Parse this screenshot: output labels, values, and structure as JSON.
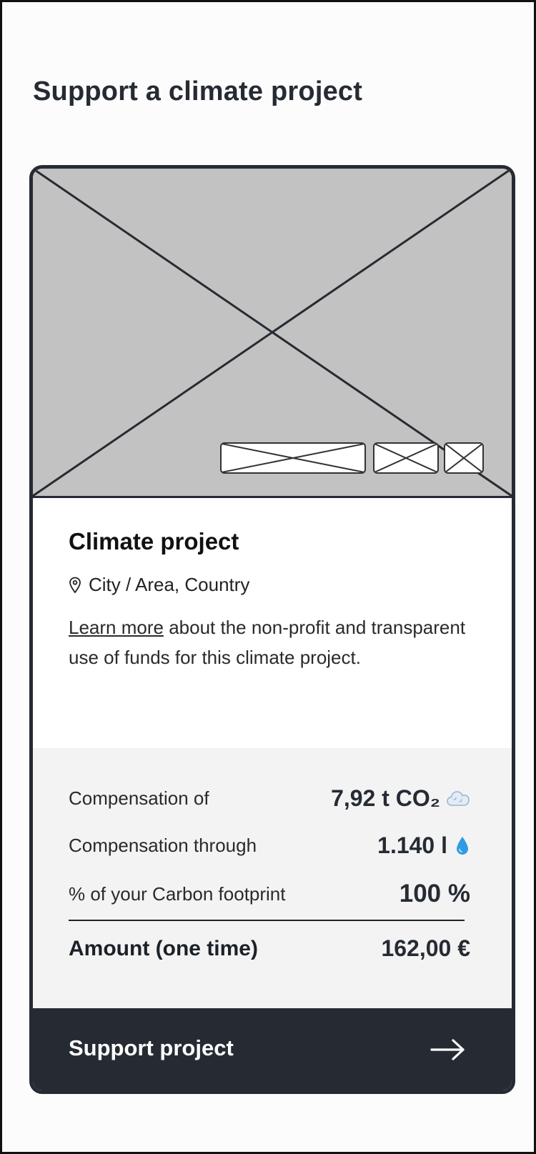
{
  "page": {
    "title": "Support a climate project"
  },
  "project": {
    "title": "Climate project",
    "location": "City / Area, Country",
    "learn_more": "Learn more",
    "description": " about the non-profit and transparent use of funds for this climate project."
  },
  "details": {
    "rows": [
      {
        "label": "Compensation of",
        "value": "7,92 t CO₂",
        "icon": "cloud-icon"
      },
      {
        "label": "Compensation through",
        "value": "1.140 l",
        "icon": "water-drop-icon"
      },
      {
        "label": "% of your Carbon footprint",
        "value": "100 %"
      }
    ],
    "total": {
      "label": "Amount (one time)",
      "value": "162,00 €"
    }
  },
  "cta": {
    "label": "Support project",
    "icon": "arrow-right-icon"
  },
  "colors": {
    "dark": "#262b33",
    "placeholder": "#c2c2c2",
    "panel": "#f3f3f4",
    "drop": "#2f9be3"
  }
}
